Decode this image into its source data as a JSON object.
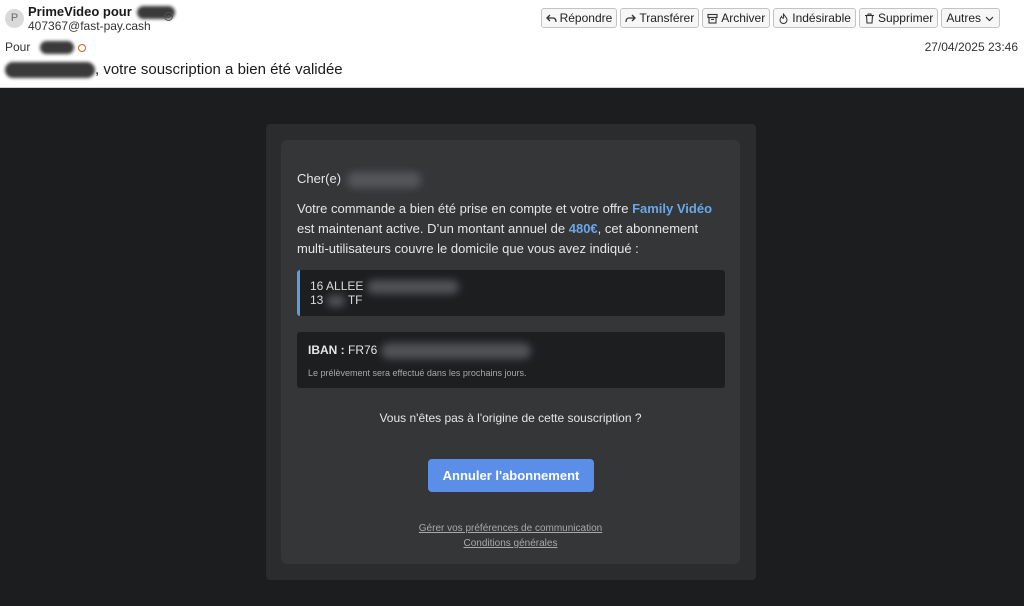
{
  "header": {
    "avatar_letter": "P",
    "sender_name": "PrimeVideo pour",
    "sender_email": "407367@fast-pay.cash",
    "to_label": "Pour",
    "date": "27/04/2025 23:46",
    "subject": ", votre souscription a bien été validée"
  },
  "toolbar": {
    "reply": "Répondre",
    "forward": "Transférer",
    "archive": "Archiver",
    "junk": "Indésirable",
    "delete": "Supprimer",
    "more": "Autres"
  },
  "email": {
    "greeting": "Cher(e)",
    "paragraph_part1": "Votre commande a bien été prise en compte et votre offre ",
    "offer_name": "Family Vidéo",
    "paragraph_part2": " est maintenant active. D’un montant annuel de ",
    "amount": "480€",
    "paragraph_part3": ", cet abonnement multi-utilisateurs couvre le domicile que vous avez indiqué :",
    "address_line1": "16 ALLEE",
    "address_line2_prefix": "13",
    "address_line2_visible": "TF",
    "iban_label": "IBAN :",
    "iban_prefix": "FR76",
    "iban_note": "Le prélèvement sera effectué dans les prochains jours.",
    "question": "Vous n'êtes pas à l'origine de cette souscription ?",
    "cancel_button": "Annuler l'abonnement",
    "footer_link1": "Gérer vos préférences de communication",
    "footer_link2": "Conditions générales"
  },
  "colors": {
    "accent_link": "#6aa7e8",
    "button": "#5a8ee9",
    "address_border": "#5b9ee6",
    "page_bg": "#1c1d1e"
  }
}
